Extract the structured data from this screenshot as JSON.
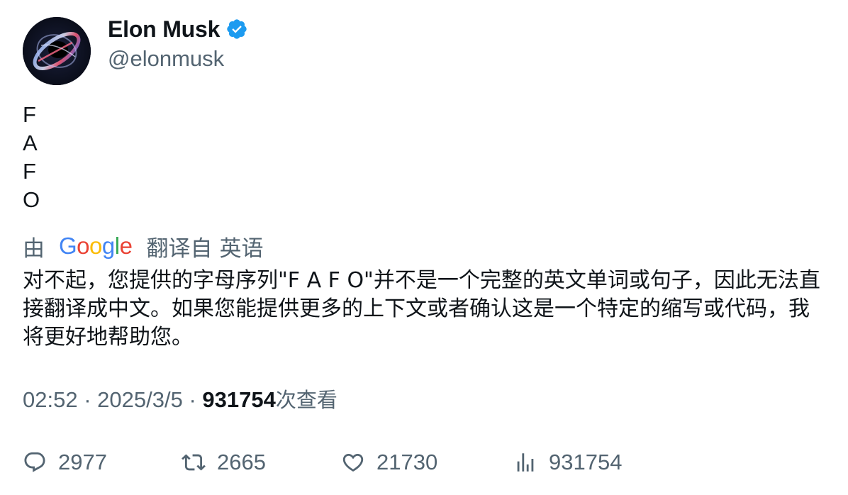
{
  "author": {
    "display_name": "Elon Musk",
    "handle": "@elonmusk",
    "verified": true,
    "verified_color": "#1d9bf0"
  },
  "tweet": {
    "lines": [
      "F",
      "A",
      "F",
      "O"
    ]
  },
  "translation": {
    "by_label": "由",
    "provider": "Google",
    "from_label": "翻译自",
    "language": "英语",
    "text": "对不起，您提供的字母序列\"F A F O\"并不是一个完整的英文单词或句子，因此无法直接翻译成中文。如果您能提供更多的上下文或者确认这是一个特定的缩写或代码，我将更好地帮助您。"
  },
  "meta": {
    "time": "02:52",
    "separator": "·",
    "date": "2025/3/5",
    "views": "931754",
    "views_label": "次查看"
  },
  "actions": {
    "replies": "2977",
    "reposts": "2665",
    "likes": "21730",
    "views": "931754"
  },
  "colors": {
    "text_primary": "#0f1419",
    "text_secondary": "#536471",
    "google_blue": "#4285F4",
    "google_red": "#EA4335",
    "google_yellow": "#FBBC05",
    "google_green": "#34A853"
  }
}
